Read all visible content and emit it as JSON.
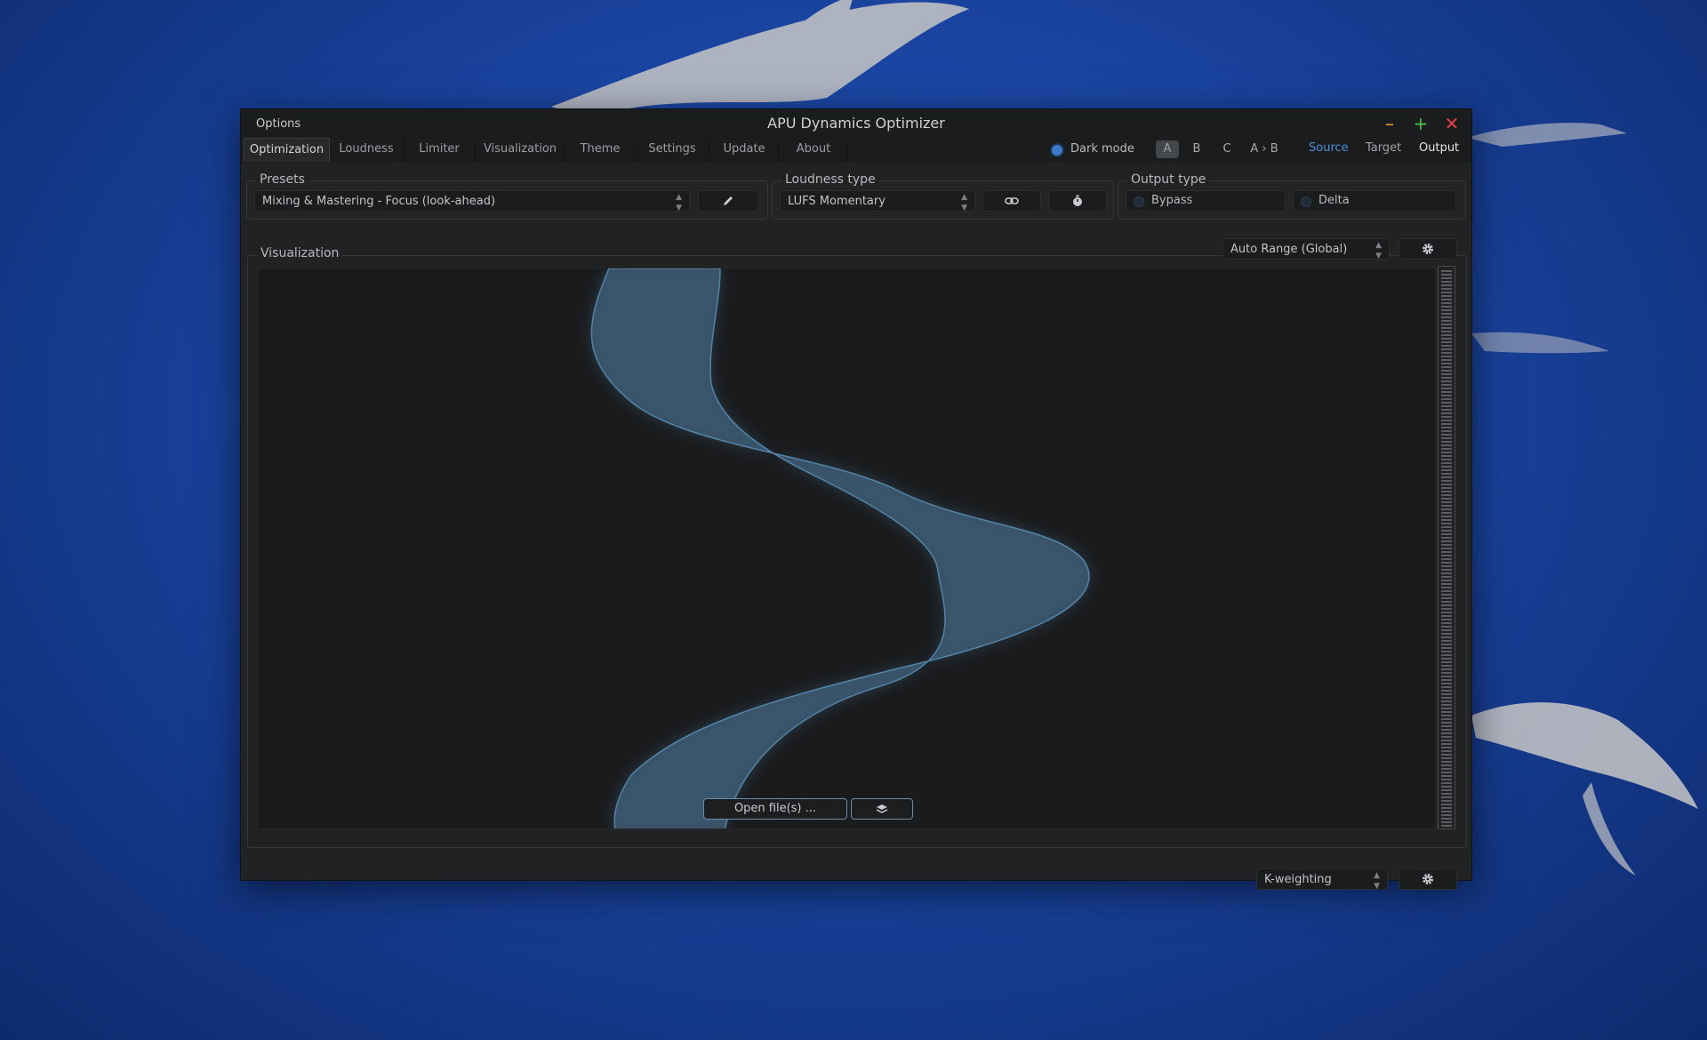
{
  "window": {
    "options_label": "Options",
    "title": "APU Dynamics Optimizer",
    "controls": [
      "minimize",
      "maximize",
      "close"
    ]
  },
  "tabs": [
    {
      "label": "Optimization",
      "active": true
    },
    {
      "label": "Loudness",
      "active": false
    },
    {
      "label": "Limiter",
      "active": false
    },
    {
      "label": "Visualization",
      "active": false
    },
    {
      "label": "Theme",
      "active": false
    },
    {
      "label": "Settings",
      "active": false
    },
    {
      "label": "Update",
      "active": false
    },
    {
      "label": "About",
      "active": false
    }
  ],
  "toolbar": {
    "dark_mode_label": "Dark mode",
    "dark_mode_on": true,
    "ab_slots": [
      {
        "label": "A",
        "active": true
      },
      {
        "label": "B",
        "active": false
      },
      {
        "label": "C",
        "active": false
      },
      {
        "label": "A › B",
        "active": false
      }
    ],
    "views": [
      {
        "label": "Source",
        "color": "#4a8fd6"
      },
      {
        "label": "Target",
        "color": "#9ea2a6"
      },
      {
        "label": "Output",
        "color": "#e4e6e8"
      }
    ]
  },
  "presets": {
    "title": "Presets",
    "selected": "Mixing & Mastering - Focus (look-ahead)",
    "edit_icon": "pencil-icon"
  },
  "loudness_type": {
    "title": "Loudness type",
    "selected": "LUFS Momentary",
    "link_icon": "link-icon",
    "timer_icon": "stopwatch-icon"
  },
  "output_type": {
    "title": "Output type",
    "options": [
      {
        "label": "Bypass",
        "selected": false
      },
      {
        "label": "Delta",
        "selected": false
      }
    ]
  },
  "visualization": {
    "title": "Visualization",
    "range_selected": "Auto Range (Global)",
    "settings_icon": "gear-icon",
    "open_files_label": "Open file(s) ...",
    "layers_icon": "layers-icon",
    "curve_color": "#4e86ad"
  },
  "footer": {
    "weighting_selected": "K-weighting",
    "settings_icon": "gear-icon"
  },
  "colors": {
    "accent": "#3d7ac7",
    "window_bg": "#202224",
    "desktop_bg": "#1a44a0"
  }
}
